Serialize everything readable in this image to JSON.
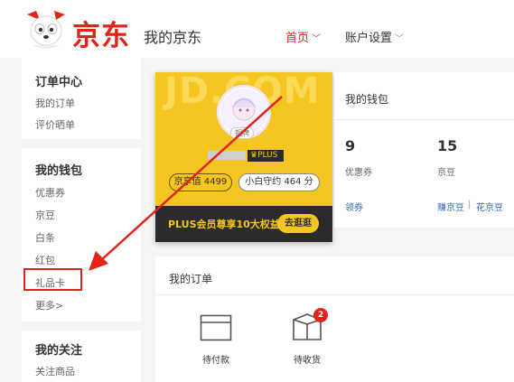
{
  "header": {
    "brand": "京东",
    "my_jd": "我的京东",
    "nav_home": "首页",
    "nav_account": "账户设置"
  },
  "sidebar": {
    "groups": [
      {
        "title": "订单中心",
        "items": [
          "我的订单",
          "评价晒单"
        ]
      },
      {
        "title": "我的钱包",
        "items": [
          "优惠券",
          "京豆",
          "白条",
          "红包",
          "礼品卡",
          "更多"
        ]
      },
      {
        "title": "我的关注",
        "items": [
          "关注商品"
        ]
      }
    ]
  },
  "profile": {
    "watermark": "JD.COM",
    "badge_text": "铜牌",
    "plus_tag": "PLUS",
    "jd_value": "京享值 4499",
    "credit": "小白守约 464 分",
    "plus_bar_text": "PLUS会员尊享10大权益",
    "plus_button": "去逛逛"
  },
  "wallet": {
    "title": "我的钱包",
    "coupons_count": "9",
    "coupons_label": "优惠券",
    "beans_count": "15",
    "beans_label": "京豆",
    "link_claim": "领券",
    "link_earn_beans": "赚京豆",
    "link_spend_beans": "花京豆",
    "link_sep": "|"
  },
  "orders": {
    "title": "我的订单",
    "pending_payment": "待付款",
    "pending_receipt": "待收货",
    "pending_receipt_count": "2"
  },
  "colors": {
    "brand_red": "#e2231a",
    "plus_gold": "#f5c522",
    "plus_dark": "#2b2b2b",
    "link_blue": "#3166bd"
  }
}
